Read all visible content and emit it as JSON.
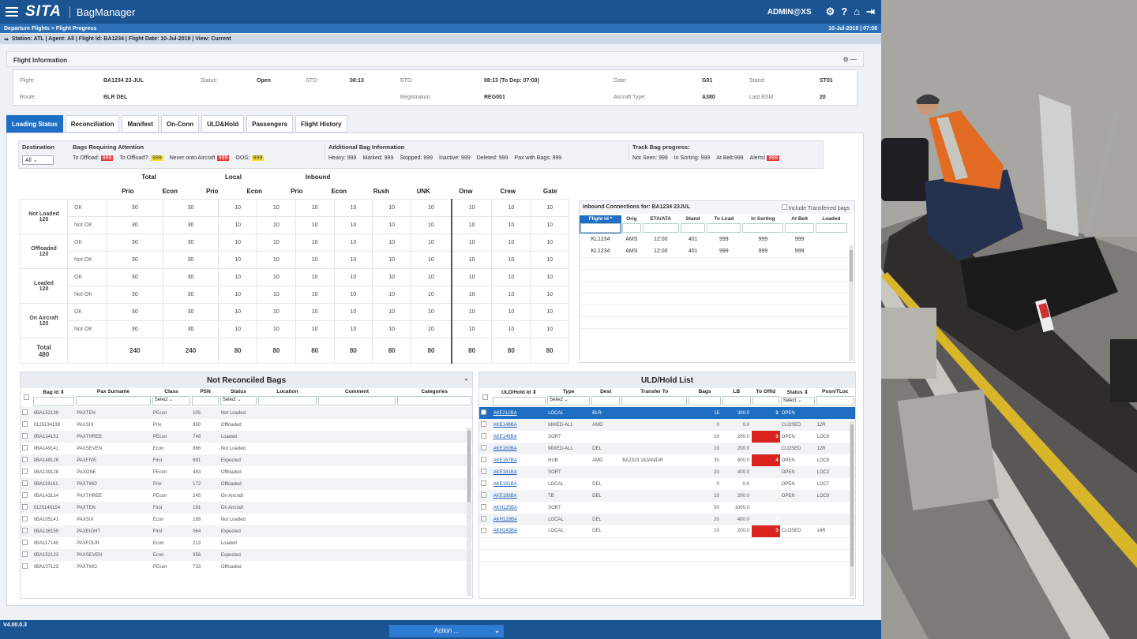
{
  "header": {
    "logo": "SITA",
    "app": "BagManager",
    "user": "ADMIN@XS"
  },
  "breadcrumb": {
    "path": "Departure Flights > Flight Progress",
    "datetime": "10-Jul-2019 | 07:08"
  },
  "context": "Station: ATL | Agent: All | Flight Id: BA1234 | Flight Date: 10-Jul-2019 | View: Current",
  "flight_info": {
    "title": "Flight Information",
    "fields": [
      {
        "label": "Flight:",
        "value": "BA1234 23-JUL"
      },
      {
        "label": "Status:",
        "value": "Open"
      },
      {
        "label": "STD:",
        "value": "08:13"
      },
      {
        "label": "ETD:",
        "value": "08:13 (To Dep: 07:00)"
      },
      {
        "label": "Gate:",
        "value": "G01"
      },
      {
        "label": "Stand:",
        "value": "ST01"
      },
      {
        "label": "Route:",
        "value": "BLR DEL"
      },
      {
        "label": "Registration:",
        "value": "REG001"
      },
      {
        "label": "Aircraft Type:",
        "value": "A380"
      },
      {
        "label": "Last BSM:",
        "value": "20"
      }
    ]
  },
  "tabs": [
    "Loading Status",
    "Reconciliation",
    "Manifest",
    "On-Conn",
    "ULD&Hold",
    "Passengers",
    "Flight History"
  ],
  "attention": {
    "destination_label": "Destination",
    "destination_value": "All",
    "bags_title": "Bags Requiring Attention",
    "bags": [
      {
        "label": "To Offload:",
        "value": "999",
        "color": "red"
      },
      {
        "label": "To Offload?:",
        "value": "999",
        "color": "yellow"
      },
      {
        "label": "Never onto Aircraft",
        "value": "999",
        "color": "red"
      },
      {
        "label": "OOG:",
        "value": "999",
        "color": "yellow"
      }
    ],
    "additional_title": "Additional Bag Information",
    "additional": [
      "Heavy: 999",
      "Marked: 999",
      "Stopped: 999",
      "Inactive: 999",
      "Deleted: 999",
      "Pax with Bags: 999"
    ],
    "track_title": "Track Bag progress:",
    "track": [
      "Not Seen: 999",
      "In Sorting: 999",
      "At Belt:999"
    ],
    "track_alert_label": "Alerts!",
    "track_alert_value": "999"
  },
  "loading": {
    "groups": [
      "Total",
      "Local",
      "Inbound"
    ],
    "columns": [
      "Prio",
      "Econ",
      "Prio",
      "Econ",
      "Prio",
      "Econ",
      "Rush",
      "UNK",
      "Onw",
      "Crew",
      "Gate"
    ],
    "status_ok": "OK",
    "status_notok": "Not OK",
    "rows": [
      {
        "label": "Not Loaded",
        "count": "120",
        "ok": [
          "30",
          "30",
          "10",
          "10",
          "10",
          "10",
          "10",
          "10",
          "10",
          "10",
          "10"
        ],
        "notok": [
          "30",
          "30",
          "10",
          "10",
          "10",
          "10",
          "10",
          "10",
          "10",
          "10",
          "10"
        ]
      },
      {
        "label": "Offloaded",
        "count": "120",
        "ok": [
          "30",
          "30",
          "10",
          "10",
          "10",
          "10",
          "10",
          "10",
          "10",
          "10",
          "10"
        ],
        "notok": [
          "30",
          "30",
          "10",
          "10",
          "10",
          "10",
          "10",
          "10",
          "10",
          "10",
          "10"
        ]
      },
      {
        "label": "Loaded",
        "count": "120",
        "ok": [
          "30",
          "30",
          "10",
          "10",
          "10",
          "10",
          "10",
          "10",
          "10",
          "10",
          "10"
        ],
        "notok": [
          "30",
          "30",
          "10",
          "10",
          "10",
          "10",
          "10",
          "10",
          "10",
          "10",
          "10"
        ]
      },
      {
        "label": "On Aircraft",
        "count": "120",
        "ok": [
          "30",
          "30",
          "10",
          "10",
          "10",
          "10",
          "10",
          "10",
          "10",
          "10",
          "10"
        ],
        "notok": [
          "30",
          "30",
          "10",
          "10",
          "10",
          "10",
          "10",
          "10",
          "10",
          "10",
          "10"
        ]
      }
    ],
    "total_label": "Total",
    "total_count": "480",
    "totals": [
      "240",
      "240",
      "80",
      "80",
      "80",
      "80",
      "80",
      "80",
      "80",
      "80",
      "80"
    ]
  },
  "inbound": {
    "title": "Inbound Connections for: BA1234 23JUL",
    "include_label": "Include Transferred bags",
    "columns": [
      "Flight Id *",
      "Orig",
      "ETA/ATA",
      "Stand",
      "To Load",
      "In Sorting",
      "At Belt",
      "Loaded"
    ],
    "rows": [
      [
        "KL1234",
        "AMS",
        "12:00",
        "401",
        "999",
        "999",
        "999",
        ""
      ],
      [
        "KL1234",
        "AMS",
        "12:00",
        "401",
        "999",
        "999",
        "999",
        ""
      ]
    ]
  },
  "not_reconciled": {
    "title": "Not Reconciled Bags",
    "columns": [
      "Bag Id ⇕",
      "Pax Surname",
      "Class",
      "PSN",
      "Status",
      "Location",
      "Comment",
      "Categories"
    ],
    "select_label": "Select",
    "rows": [
      [
        "0BA152139",
        "PAXTEN",
        "PEcon",
        "105",
        "Not Loaded"
      ],
      [
        "0125134139",
        "PAXSIX",
        "Prio",
        "950",
        "Offloaded"
      ],
      [
        "0BA134151",
        "PAXTHREE",
        "PEcon",
        "748",
        "Loaded"
      ],
      [
        "0BA149141",
        "PAXSEVEN",
        "Econ",
        "886",
        "Not Loaded"
      ],
      [
        "0BA148126",
        "PAXFIVE",
        "First",
        "691",
        "Expected"
      ],
      [
        "0BA139128",
        "PAXONE",
        "PEcon",
        "483",
        "Offloaded"
      ],
      [
        "0BA118161",
        "PAXTWO",
        "Prio",
        "172",
        "Offloaded"
      ],
      [
        "0BA143134",
        "PAXTHREE",
        "PEcon",
        "245",
        "On Aircraft"
      ],
      [
        "0125148154",
        "PAXTEN",
        "First",
        "191",
        "On Aircraft"
      ],
      [
        "0BA105141",
        "PAXSIX",
        "Econ",
        "189",
        "Not Loaded"
      ],
      [
        "0BA136159",
        "PAXEIGHT",
        "First",
        "064",
        "Expected"
      ],
      [
        "0BA117148",
        "PAXFOUR",
        "Econ",
        "213",
        "Loaded"
      ],
      [
        "0BA152123",
        "PAXSEVEN",
        "Econ",
        "356",
        "Expected"
      ],
      [
        "0BA107123",
        "PAXTWO",
        "PEcon",
        "733",
        "Offloaded"
      ]
    ]
  },
  "uld": {
    "title": "ULD/Hold List",
    "columns": [
      "ULD/Hold Id ⇕",
      "Type",
      "Dest",
      "Transfer To",
      "Bags",
      "LB",
      "To Offld",
      "Status ⇕",
      "Posn/TLoc"
    ],
    "select_label": "Select",
    "rows": [
      [
        "AKE212BA",
        "LOCAL",
        "BLR",
        "",
        "15",
        "300.0",
        "3",
        "OPEN",
        ""
      ],
      [
        "AKE148BA",
        "MIXED-ALL",
        "AMD",
        "",
        "0",
        "0.0",
        "",
        "CLOSED",
        "12R"
      ],
      [
        "AKE148BA",
        "SORT",
        "",
        "",
        "10",
        "200.0",
        "3",
        "OPEN",
        "LOC8"
      ],
      [
        "AKE160BA",
        "MIXED-ALL",
        "DEL",
        "",
        "10",
        "200.0",
        "3",
        "CLOSED",
        "12R"
      ],
      [
        "AKE167BA",
        "HUB",
        "AMD",
        "BA2323 18JAN/DR",
        "30",
        "600.0",
        "4",
        "OPEN",
        "LOC8"
      ],
      [
        "AKE181BA",
        "SORT",
        "",
        "",
        "20",
        "400.0",
        "3",
        "OPEN",
        "LOC2"
      ],
      [
        "AKE181BA",
        "LOCAL",
        "DEL",
        "",
        "0",
        "0.0",
        "",
        "OPEN",
        "LOC7"
      ],
      [
        "AKE188BA",
        "TB",
        "DEL",
        "",
        "10",
        "200.0",
        "3",
        "OPEN",
        "LOC9"
      ],
      [
        "AKH125BA",
        "SORT",
        "",
        "",
        "50",
        "1000.0",
        "",
        "",
        ""
      ],
      [
        "AKH128BA",
        "LOCAL",
        "DEL",
        "",
        "20",
        "400.0",
        "3",
        "",
        ""
      ],
      [
        "AKH143BA",
        "LOCAL",
        "DEL",
        "",
        "10",
        "200.0",
        "3",
        "CLOSED",
        "14R"
      ]
    ]
  },
  "footer": {
    "version": "V4.00.0.3",
    "action": "Action ..."
  }
}
